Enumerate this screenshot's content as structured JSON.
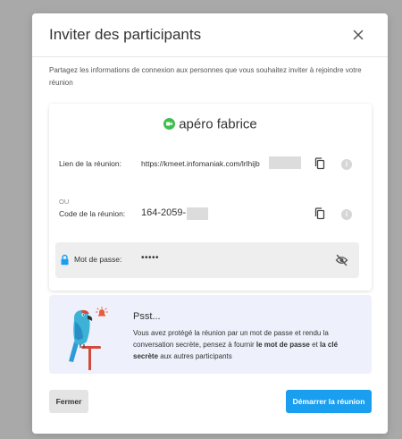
{
  "modal": {
    "title": "Inviter des participants",
    "close_icon": "close-icon",
    "intro": "Partagez les informations de connexion aux personnes que vous souhaitez inviter à rejoindre votre réunion"
  },
  "meeting": {
    "name": "apéro fabrice",
    "status_color": "#3ebf4d",
    "link_label": "Lien de la réunion:",
    "link_value": "https://kmeet.infomaniak.com/lrlhijb",
    "separator": "OU",
    "code_label": "Code de la réunion:",
    "code_value": "164-2059-",
    "password_label": "Mot de passe:",
    "password_value": "•••••"
  },
  "icons": {
    "copy": "copy-icon",
    "info": "info-icon",
    "lock": "lock-icon",
    "eye_off": "eye-off-icon",
    "video": "video-icon",
    "parrot": "parrot-illustration",
    "alarm": "alarm-bell-icon"
  },
  "psst": {
    "title": "Psst...",
    "text_part1": "Vous avez protégé la réunion par un mot de passe et rendu la conversation secrète, pensez à fournir ",
    "bold1": "le mot de passe",
    "text_part2": " et ",
    "bold2": "la clé secrète",
    "text_part3": " aux autres participants"
  },
  "footer": {
    "close_label": "Fermer",
    "start_label": "Démarrer la réunion"
  },
  "colors": {
    "accent": "#1a9ef0",
    "meeting_status": "#3ebf4d",
    "psst_bg": "#eef1fb"
  }
}
